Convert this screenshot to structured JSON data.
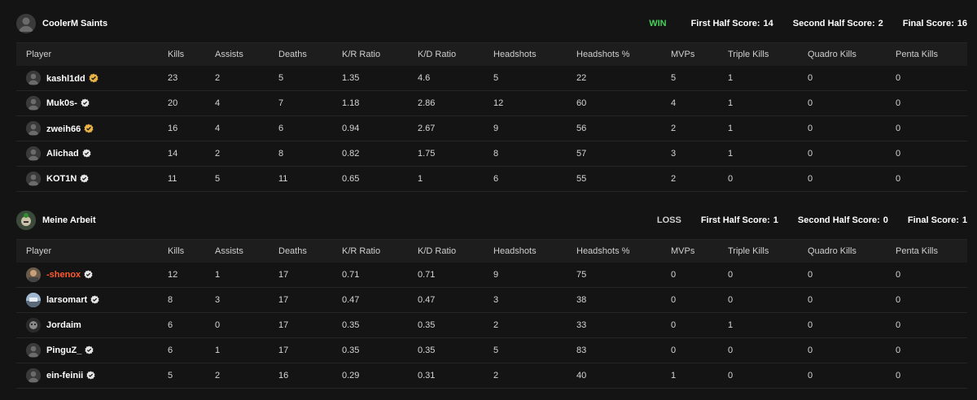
{
  "columns": [
    "Player",
    "Kills",
    "Assists",
    "Deaths",
    "K/R Ratio",
    "K/D Ratio",
    "Headshots",
    "Headshots %",
    "MVPs",
    "Triple Kills",
    "Quadro Kills",
    "Penta Kills"
  ],
  "teams": [
    {
      "name": "CoolerM Saints",
      "result": "WIN",
      "first_half_label": "First Half Score:",
      "first_half": "14",
      "second_half_label": "Second Half Score:",
      "second_half": "2",
      "final_label": "Final Score:",
      "final": "16",
      "players": [
        {
          "name": "kashl1dd",
          "badge": "gold-badge-icon",
          "stats": [
            "23",
            "2",
            "5",
            "1.35",
            "4.6",
            "5",
            "22",
            "5",
            "1",
            "0",
            "0"
          ]
        },
        {
          "name": "Muk0s-",
          "badge": "verified-check-icon",
          "stats": [
            "20",
            "4",
            "7",
            "1.18",
            "2.86",
            "12",
            "60",
            "4",
            "1",
            "0",
            "0"
          ]
        },
        {
          "name": "zweih66",
          "badge": "gold-badge-icon",
          "stats": [
            "16",
            "4",
            "6",
            "0.94",
            "2.67",
            "9",
            "56",
            "2",
            "1",
            "0",
            "0"
          ]
        },
        {
          "name": "Alichad",
          "badge": "verified-check-icon",
          "stats": [
            "14",
            "2",
            "8",
            "0.82",
            "1.75",
            "8",
            "57",
            "3",
            "1",
            "0",
            "0"
          ]
        },
        {
          "name": "KOT1N",
          "badge": "verified-check-icon",
          "stats": [
            "11",
            "5",
            "11",
            "0.65",
            "1",
            "6",
            "55",
            "2",
            "0",
            "0",
            "0"
          ]
        }
      ]
    },
    {
      "name": "Meine Arbeit",
      "result": "LOSS",
      "first_half_label": "First Half Score:",
      "first_half": "1",
      "second_half_label": "Second Half Score:",
      "second_half": "0",
      "final_label": "Final Score:",
      "final": "1",
      "players": [
        {
          "name": "-shenox",
          "badge": "verified-check-icon",
          "highlight": true,
          "stats": [
            "12",
            "1",
            "17",
            "0.71",
            "0.71",
            "9",
            "75",
            "0",
            "0",
            "0",
            "0"
          ]
        },
        {
          "name": "larsomart",
          "badge": "verified-check-icon",
          "stats": [
            "8",
            "3",
            "17",
            "0.47",
            "0.47",
            "3",
            "38",
            "0",
            "0",
            "0",
            "0"
          ]
        },
        {
          "name": "Jordaim",
          "badge": "",
          "stats": [
            "6",
            "0",
            "17",
            "0.35",
            "0.35",
            "2",
            "33",
            "0",
            "1",
            "0",
            "0"
          ]
        },
        {
          "name": "PinguZ_",
          "badge": "verified-check-icon",
          "stats": [
            "6",
            "1",
            "17",
            "0.35",
            "0.35",
            "5",
            "83",
            "0",
            "0",
            "0",
            "0"
          ]
        },
        {
          "name": "ein-feinii",
          "badge": "verified-check-icon",
          "stats": [
            "5",
            "2",
            "16",
            "0.29",
            "0.31",
            "2",
            "40",
            "1",
            "0",
            "0",
            "0"
          ]
        }
      ]
    }
  ],
  "colors": {
    "background": "#141414",
    "header_row": "#1d1d1d",
    "win": "#45d15a",
    "highlight_player": "#ff5a2c",
    "text": "#d6d6d6"
  }
}
